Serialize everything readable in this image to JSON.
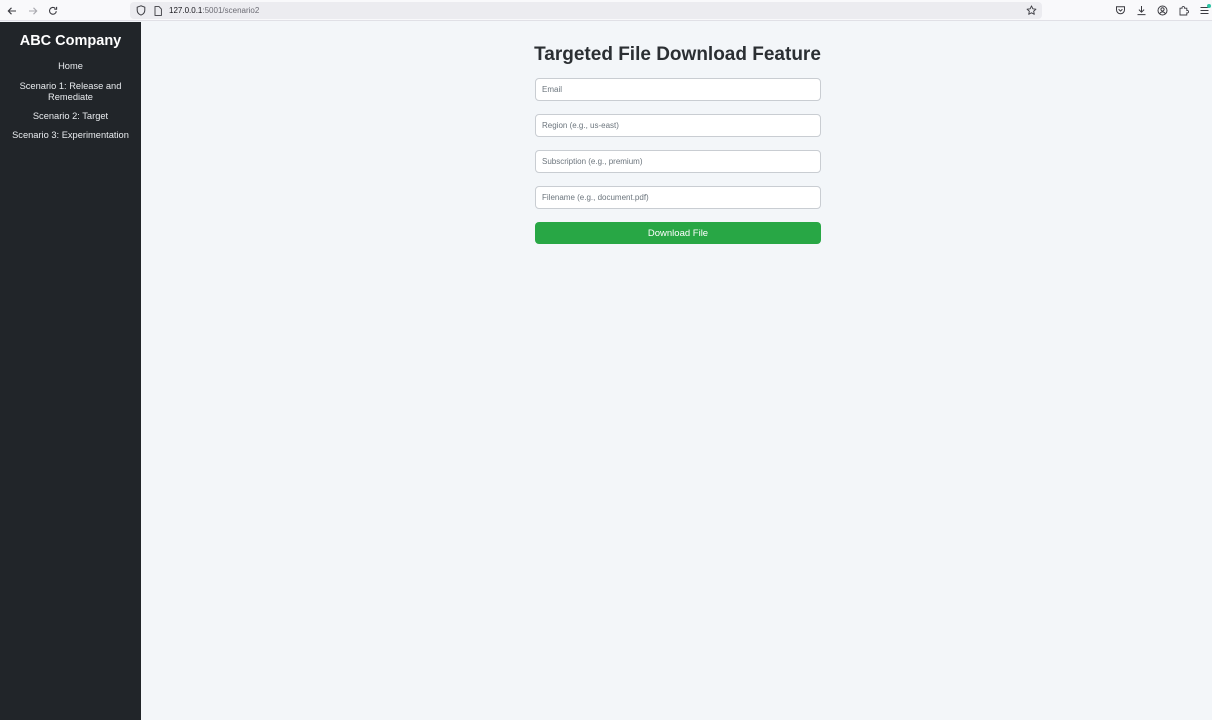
{
  "browser": {
    "url_host": "127.0.0.1",
    "url_rest": ":5001/scenario2",
    "icons": [
      "back-icon",
      "forward-icon",
      "reload-icon",
      "shield-icon",
      "page-icon",
      "bookmark-star-icon",
      "pocket-icon",
      "download-icon",
      "account-icon",
      "extensions-icon",
      "menu-icon"
    ]
  },
  "sidebar": {
    "title": "ABC Company",
    "items": [
      {
        "label": "Home"
      },
      {
        "label": "Scenario 1: Release and Remediate"
      },
      {
        "label": "Scenario 2: Target"
      },
      {
        "label": "Scenario 3: Experimentation"
      }
    ]
  },
  "main": {
    "title": "Targeted File Download Feature",
    "fields": {
      "email": {
        "placeholder": "Email",
        "value": ""
      },
      "region": {
        "placeholder": "Region (e.g., us-east)",
        "value": ""
      },
      "subscription": {
        "placeholder": "Subscription (e.g., premium)",
        "value": ""
      },
      "filename": {
        "placeholder": "Filename (e.g., document.pdf)",
        "value": ""
      }
    },
    "submit_label": "Download File"
  },
  "colors": {
    "sidebar_bg": "#212529",
    "page_bg": "#f3f6f9",
    "button_green": "#28a745"
  }
}
